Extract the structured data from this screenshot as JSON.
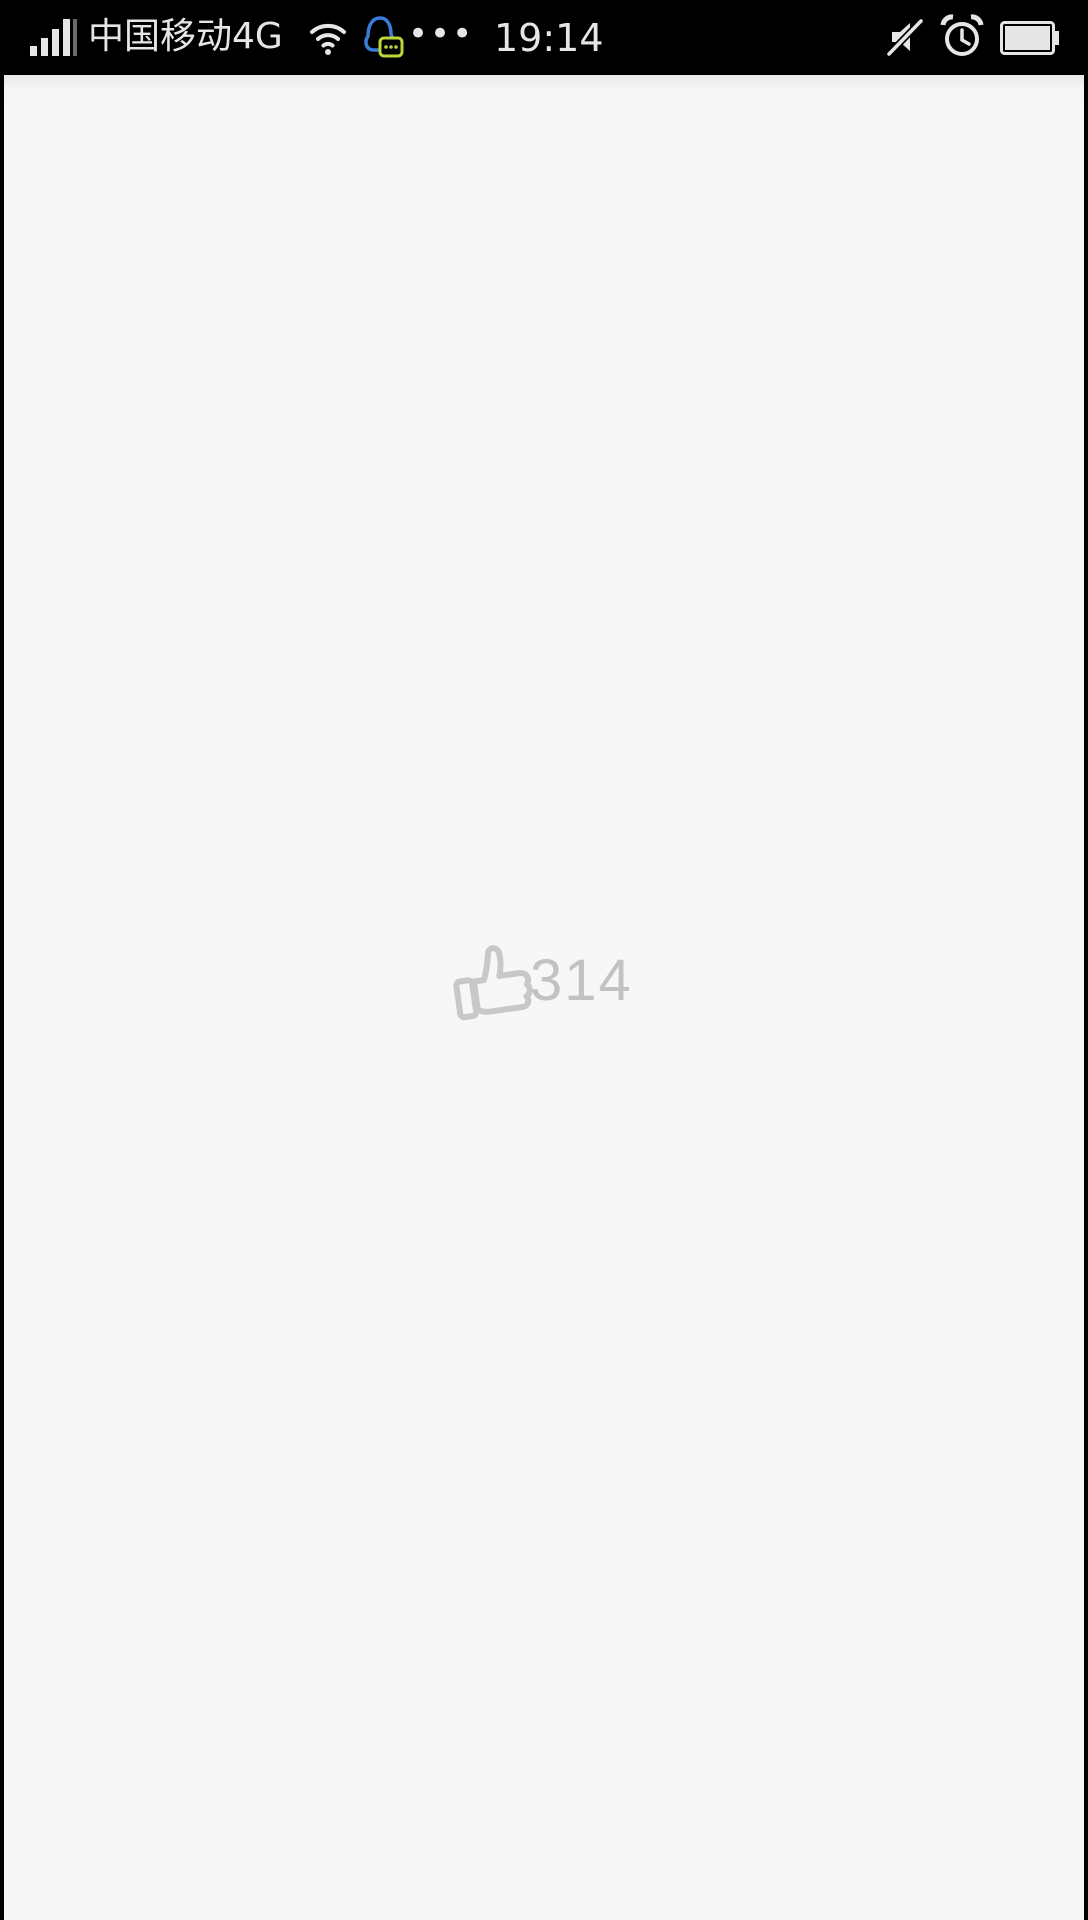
{
  "status_bar": {
    "carrier": "中国移动4G",
    "more": "•••",
    "time": "19:14",
    "signal_icon": "signal-bars-icon",
    "wifi_icon": "wifi-icon",
    "qq_icon": "qq-notification-icon",
    "mute_icon": "vibrate-off-icon",
    "alarm_icon": "alarm-clock-icon",
    "battery_icon": "battery-icon"
  },
  "content": {
    "like": {
      "icon": "thumbs-up-icon",
      "count": "314"
    }
  },
  "colors": {
    "status_bar_bg": "#000000",
    "page_bg": "#f7f7f7",
    "like_color": "#c2c2c2"
  }
}
